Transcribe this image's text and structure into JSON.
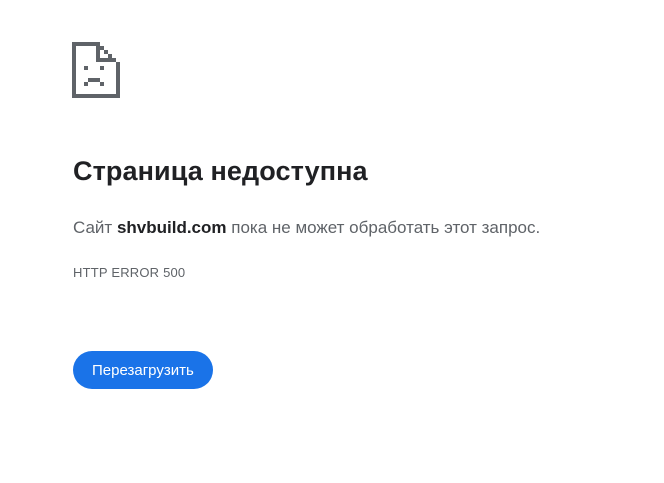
{
  "icon": {
    "name": "sad-page-icon",
    "color": "#5f6368"
  },
  "error": {
    "title": "Страница недоступна",
    "message_prefix": "Сайт ",
    "domain": "shvbuild.com",
    "message_suffix": " пока не может обработать этот запрос.",
    "code": "HTTP ERROR 500"
  },
  "actions": {
    "reload_label": "Перезагрузить"
  },
  "colors": {
    "accent": "#1a73e8",
    "title_text": "#202124",
    "secondary_text": "#5f6368"
  }
}
